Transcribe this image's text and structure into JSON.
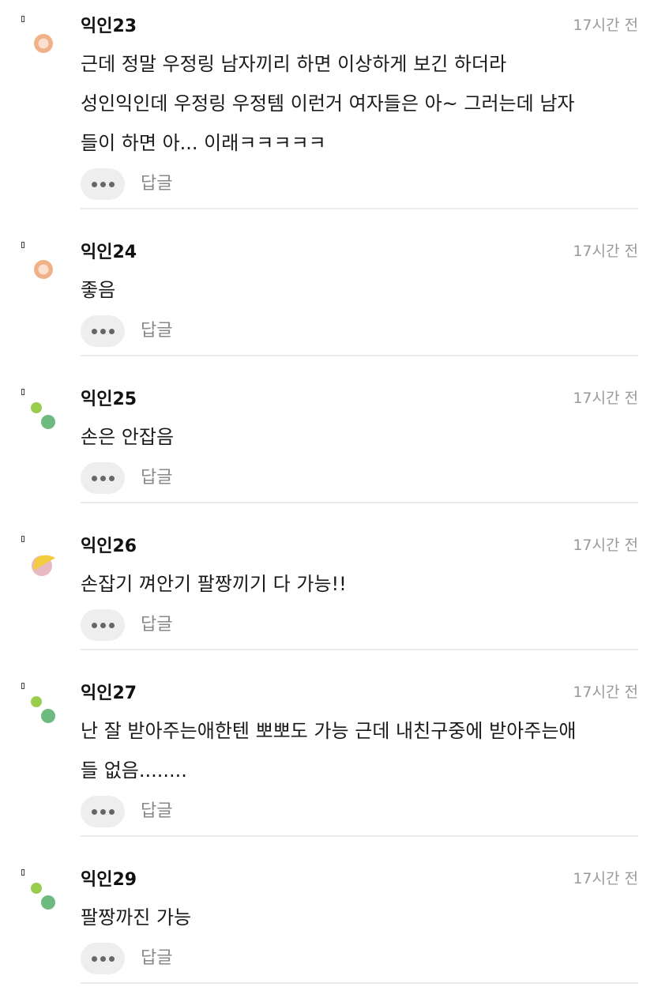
{
  "comments": [
    {
      "author": "익인23",
      "time": "17시간 전",
      "lines": [
        "근데 정말 우정링 남자끼리 하면 이상하게 보긴 하더라",
        "성인익인데 우정링 우정템 이런거 여자들은 아~ 그러는데 남자",
        "들이 하면 아... 이래ㅋㅋㅋㅋㅋ"
      ],
      "reply_label": "답글",
      "avatar_icon": "orange-circle-avatar-icon"
    },
    {
      "author": "익인24",
      "time": "17시간 전",
      "lines": [
        "좋음"
      ],
      "reply_label": "답글",
      "avatar_icon": "orange-circle-avatar-icon"
    },
    {
      "author": "익인25",
      "time": "17시간 전",
      "lines": [
        "손은 안잡음"
      ],
      "reply_label": "답글",
      "avatar_icon": "green-dots-avatar-icon"
    },
    {
      "author": "익인26",
      "time": "17시간 전",
      "lines": [
        "손잡기 껴안기 팔짱끼기 다 가능!!"
      ],
      "reply_label": "답글",
      "avatar_icon": "yellow-pink-avatar-icon"
    },
    {
      "author": "익인27",
      "time": "17시간 전",
      "lines": [
        "난 잘 받아주는애한텐 뽀뽀도 가능 근데 내친구중에 받아주는애",
        "들 없음........"
      ],
      "reply_label": "답글",
      "avatar_icon": "green-dots-avatar-icon"
    },
    {
      "author": "익인29",
      "time": "17시간 전",
      "lines": [
        "팔짱까진 가능"
      ],
      "reply_label": "답글",
      "avatar_icon": "green-dots-avatar-icon"
    }
  ],
  "colors": {
    "orange_ring": "#f0b088",
    "orange_core": "#fbe0cf",
    "green_light": "#9acd4e",
    "green_dark": "#6cba7f",
    "yellow": "#f2cd3f",
    "pink": "#e9b9c2",
    "meta_gray": "#999999",
    "divider": "#ebebeb"
  }
}
